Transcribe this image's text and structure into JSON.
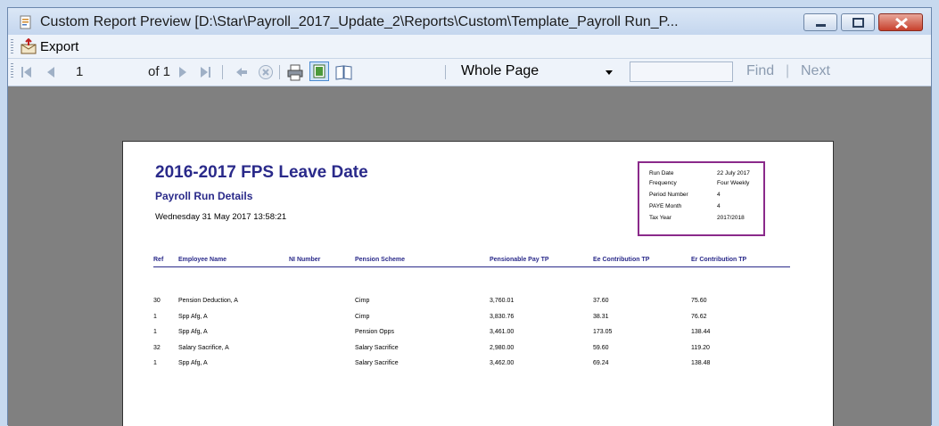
{
  "window": {
    "title": "Custom Report Preview [D:\\Star\\Payroll_2017_Update_2\\Reports\\Custom\\Template_Payroll Run_P..."
  },
  "menu": {
    "export_label": "Export"
  },
  "toolbar": {
    "page_current": "1",
    "page_total": "of 1",
    "zoom_value": "Whole Page",
    "find_value": "",
    "find_label": "Find",
    "find_sep": "|",
    "next_label": "Next"
  },
  "report": {
    "title": "2016-2017 FPS Leave Date",
    "subtitle": "Payroll Run Details",
    "datetime": "Wednesday 31 May 2017 13:58:21",
    "info": [
      {
        "label": "Run Date",
        "value": "22 July 2017"
      },
      {
        "label": "Frequency",
        "value": "Four Weekly"
      },
      {
        "label": "Period Number",
        "value": "4"
      },
      {
        "label": "PAYE Month",
        "value": "4"
      },
      {
        "label": "Tax Year",
        "value": "2017/2018"
      }
    ],
    "columns": [
      "Ref",
      "Employee Name",
      "NI Number",
      "Pension Scheme",
      "Pensionable Pay TP",
      "Ee Contribution TP",
      "Er Contribution TP"
    ],
    "rows": [
      {
        "ref": "30",
        "name": "Pension Deduction, A",
        "ni": "",
        "scheme": "Cimp",
        "pay": "3,760.01",
        "ee": "37.60",
        "er": "75.60"
      },
      {
        "ref": "1",
        "name": "Spp Afg, A",
        "ni": "",
        "scheme": "Cimp",
        "pay": "3,830.76",
        "ee": "38.31",
        "er": "76.62"
      },
      {
        "ref": "1",
        "name": "Spp Afg, A",
        "ni": "",
        "scheme": "Pension Opps",
        "pay": "3,461.00",
        "ee": "173.05",
        "er": "138.44"
      },
      {
        "ref": "32",
        "name": "Salary Sacrifice, A",
        "ni": "",
        "scheme": "Salary Sacrifice",
        "pay": "2,980.00",
        "ee": "59.60",
        "er": "119.20"
      },
      {
        "ref": "1",
        "name": "Spp Afg, A",
        "ni": "",
        "scheme": "Salary Sacrifice",
        "pay": "3,462.00",
        "ee": "69.24",
        "er": "138.48"
      }
    ]
  }
}
